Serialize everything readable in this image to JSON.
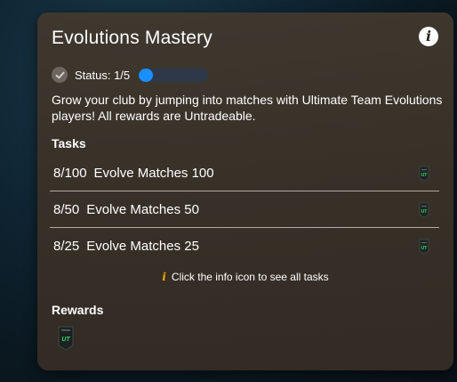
{
  "panel": {
    "title": "Evolutions Mastery",
    "info_icon": "info-icon"
  },
  "status": {
    "label": "Status: 1/5",
    "progress_fraction": 0.2,
    "progress_color": "#1a8fff",
    "check_icon": "check-icon"
  },
  "description": "Grow your club by jumping into matches with Ultimate Team Evolutions players! All rewards are Untradeable.",
  "tasks": {
    "heading": "Tasks",
    "items": [
      {
        "progress": "8/100",
        "name": "Evolve Matches 100",
        "icon": "pack-icon"
      },
      {
        "progress": "8/50",
        "name": "Evolve Matches 50",
        "icon": "pack-icon"
      },
      {
        "progress": "8/25",
        "name": "Evolve Matches 25",
        "icon": "pack-icon"
      }
    ],
    "hint": "Click the info icon to see all tasks",
    "hint_icon": "i"
  },
  "rewards": {
    "heading": "Rewards",
    "pack_label": "UT",
    "icon": "ut-pack-icon"
  }
}
